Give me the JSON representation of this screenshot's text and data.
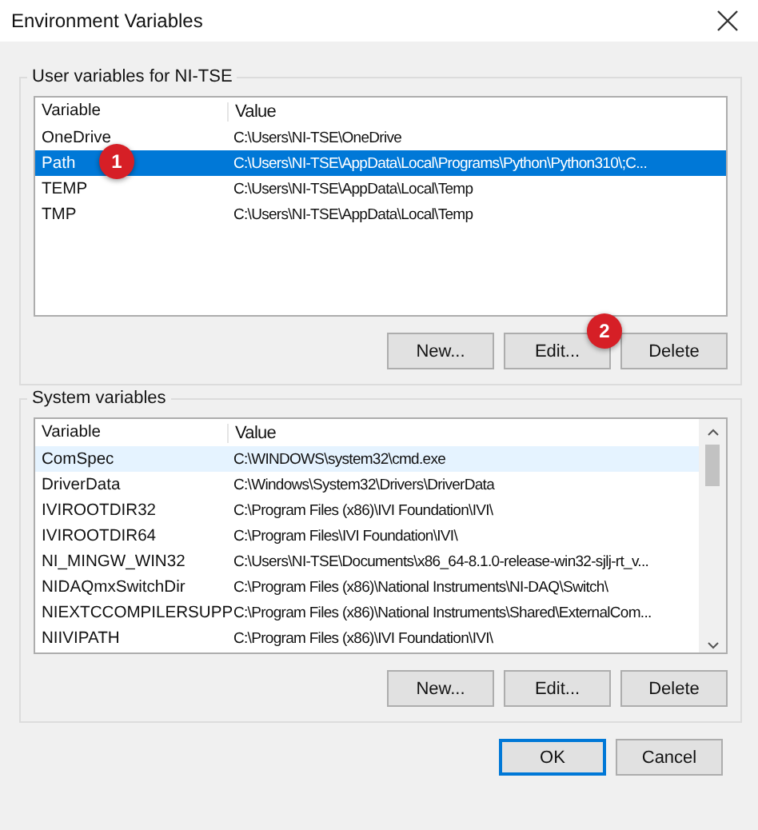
{
  "window": {
    "title": "Environment Variables"
  },
  "user_variables": {
    "label": "User variables for NI-TSE",
    "columns": [
      "Variable",
      "Value"
    ],
    "rows": [
      {
        "variable": "OneDrive",
        "value": "C:\\Users\\NI-TSE\\OneDrive",
        "selected": false
      },
      {
        "variable": "Path",
        "value": "C:\\Users\\NI-TSE\\AppData\\Local\\Programs\\Python\\Python310\\;C...",
        "selected": true
      },
      {
        "variable": "TEMP",
        "value": "C:\\Users\\NI-TSE\\AppData\\Local\\Temp",
        "selected": false
      },
      {
        "variable": "TMP",
        "value": "C:\\Users\\NI-TSE\\AppData\\Local\\Temp",
        "selected": false
      }
    ],
    "buttons": [
      "New...",
      "Edit...",
      "Delete"
    ]
  },
  "system_variables": {
    "label": "System variables",
    "columns": [
      "Variable",
      "Value"
    ],
    "rows": [
      {
        "variable": "ComSpec",
        "value": "C:\\WINDOWS\\system32\\cmd.exe",
        "hovered": true
      },
      {
        "variable": "DriverData",
        "value": "C:\\Windows\\System32\\Drivers\\DriverData",
        "hovered": false
      },
      {
        "variable": "IVIROOTDIR32",
        "value": "C:\\Program Files (x86)\\IVI Foundation\\IVI\\",
        "hovered": false
      },
      {
        "variable": "IVIROOTDIR64",
        "value": "C:\\Program Files\\IVI Foundation\\IVI\\",
        "hovered": false
      },
      {
        "variable": "NI_MINGW_WIN32",
        "value": "C:\\Users\\NI-TSE\\Documents\\x86_64-8.1.0-release-win32-sjlj-rt_v...",
        "hovered": false
      },
      {
        "variable": "NIDAQmxSwitchDir",
        "value": "C:\\Program Files (x86)\\National Instruments\\NI-DAQ\\Switch\\",
        "hovered": false
      },
      {
        "variable": "NIEXTCCOMPILERSUPP",
        "value": "C:\\Program Files (x86)\\National Instruments\\Shared\\ExternalCom...",
        "hovered": false
      },
      {
        "variable": "NIIVIPATH",
        "value": "C:\\Program Files (x86)\\IVI Foundation\\IVI\\",
        "hovered": false
      }
    ],
    "buttons": [
      "New...",
      "Edit...",
      "Delete"
    ]
  },
  "dialog_buttons": [
    {
      "label": "OK",
      "default": true
    },
    {
      "label": "Cancel",
      "default": false
    }
  ],
  "callouts": [
    {
      "number": "1"
    },
    {
      "number": "2"
    }
  ]
}
